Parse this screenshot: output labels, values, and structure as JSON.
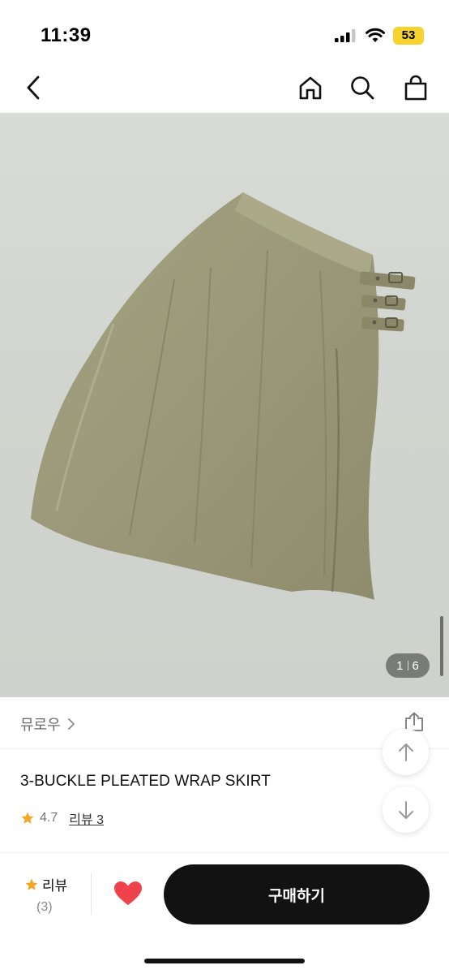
{
  "status_bar": {
    "time": "11:39",
    "battery": "53",
    "icons": [
      "signal-icon",
      "wifi-icon",
      "battery-icon"
    ]
  },
  "nav": {
    "icons": [
      "back-chevron-icon",
      "home-icon",
      "search-icon",
      "shopping-bag-icon"
    ]
  },
  "gallery": {
    "current": "1",
    "total": "6"
  },
  "product": {
    "brand": "뮤로우",
    "title": "3-BUCKLE PLEATED WRAP SKIRT",
    "rating": "4.7",
    "review_link": "리뷰 3"
  },
  "bottom_bar": {
    "review_label": "리뷰",
    "review_count": "(3)",
    "buy_label": "구매하기"
  },
  "colors": {
    "star": "#f5a623",
    "heart": "#f0424a",
    "buy_button": "#121212",
    "skirt": "#9a9878"
  }
}
